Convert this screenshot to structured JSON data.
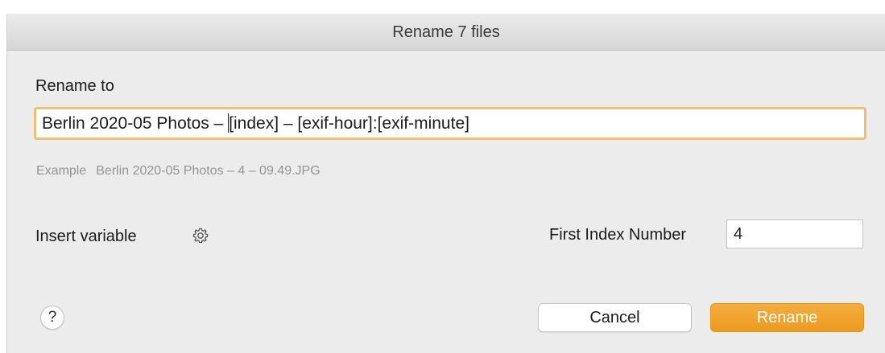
{
  "dialog": {
    "title": "Rename 7 files",
    "rename_to_label": "Rename to",
    "name_before_caret": "Berlin 2020-05 Photos – ",
    "name_after_caret": "[index] – [exif-hour]:[exif-minute]",
    "example_label": "Example",
    "example_value": "Berlin 2020-05 Photos – 4 – 09.49.JPG",
    "insert_variable_label": "Insert variable",
    "first_index_label": "First Index Number",
    "first_index_value": "4",
    "help_label": "?",
    "cancel_label": "Cancel",
    "rename_label": "Rename"
  },
  "icons": {
    "gear": "gear-icon"
  },
  "colors": {
    "accent": "#ec9a1f",
    "focus_ring": "#f0bf74",
    "background": "#ececec"
  }
}
